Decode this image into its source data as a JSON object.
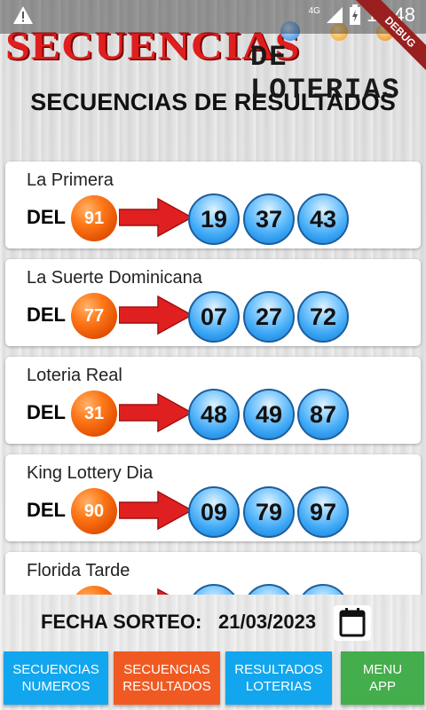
{
  "status_bar": {
    "network": "4G",
    "time": "15:48"
  },
  "header": {
    "logo_main": "SECUENCIAS",
    "logo_sub": "DE LOTERIAS",
    "debug_badge": "DEBUG"
  },
  "page_title": "SECUENCIAS DE RESULTADOS",
  "del_label": "DEL",
  "results": [
    {
      "name": "La Primera",
      "from": "91",
      "numbers": [
        "19",
        "37",
        "43"
      ]
    },
    {
      "name": "La Suerte Dominicana",
      "from": "77",
      "numbers": [
        "07",
        "27",
        "72"
      ]
    },
    {
      "name": "Loteria Real",
      "from": "31",
      "numbers": [
        "48",
        "49",
        "87"
      ]
    },
    {
      "name": "King Lottery Dia",
      "from": "90",
      "numbers": [
        "09",
        "79",
        "97"
      ]
    },
    {
      "name": "Florida Tarde",
      "from": "",
      "numbers": [
        "",
        "",
        ""
      ]
    }
  ],
  "date_row": {
    "label": "FECHA SORTEO:",
    "value": "21/03/2023"
  },
  "bottom_nav": [
    {
      "label": "SECUENCIAS\nNUMEROS",
      "color": "#12a6ee"
    },
    {
      "label": "SECUENCIAS\nRESULTADOS",
      "color": "#f05a22"
    },
    {
      "label": "RESULTADOS\nLOTERIAS",
      "color": "#12a6ee"
    },
    {
      "label": "MENU\nAPP",
      "color": "#44ad4c"
    }
  ],
  "colors": {
    "orange_ball": "#ff7a1a",
    "blue_ball": "#3aa6f5",
    "arrow": "#e02020",
    "logo_red": "#e01e1e"
  },
  "icons": [
    "warning-icon",
    "signal-icon",
    "battery-icon",
    "calendar-icon",
    "arrow-icon"
  ]
}
